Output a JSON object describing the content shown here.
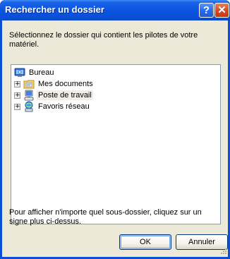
{
  "window": {
    "title": "Rechercher un dossier",
    "help_button": "?",
    "close_button": "✕"
  },
  "dialog": {
    "instructions": "Sélectionnez le dossier qui contient les pilotes de votre matériel.",
    "hint": "Pour afficher n'importe quel sous-dossier, cliquez sur un signe plus ci-dessus."
  },
  "tree": {
    "root": {
      "label": "Bureau",
      "icon": "desktop-icon"
    },
    "items": [
      {
        "label": "Mes documents",
        "icon": "my-documents-folder-icon",
        "expander": "+"
      },
      {
        "label": "Poste de travail",
        "icon": "my-computer-icon",
        "expander": "+",
        "selected": true
      },
      {
        "label": "Favoris réseau",
        "icon": "network-places-icon",
        "expander": "+"
      }
    ]
  },
  "buttons": {
    "ok": "OK",
    "cancel": "Annuler"
  },
  "colors": {
    "titlebar": "#0a4fd6",
    "client": "#ece9d8",
    "close": "#d84b25"
  }
}
